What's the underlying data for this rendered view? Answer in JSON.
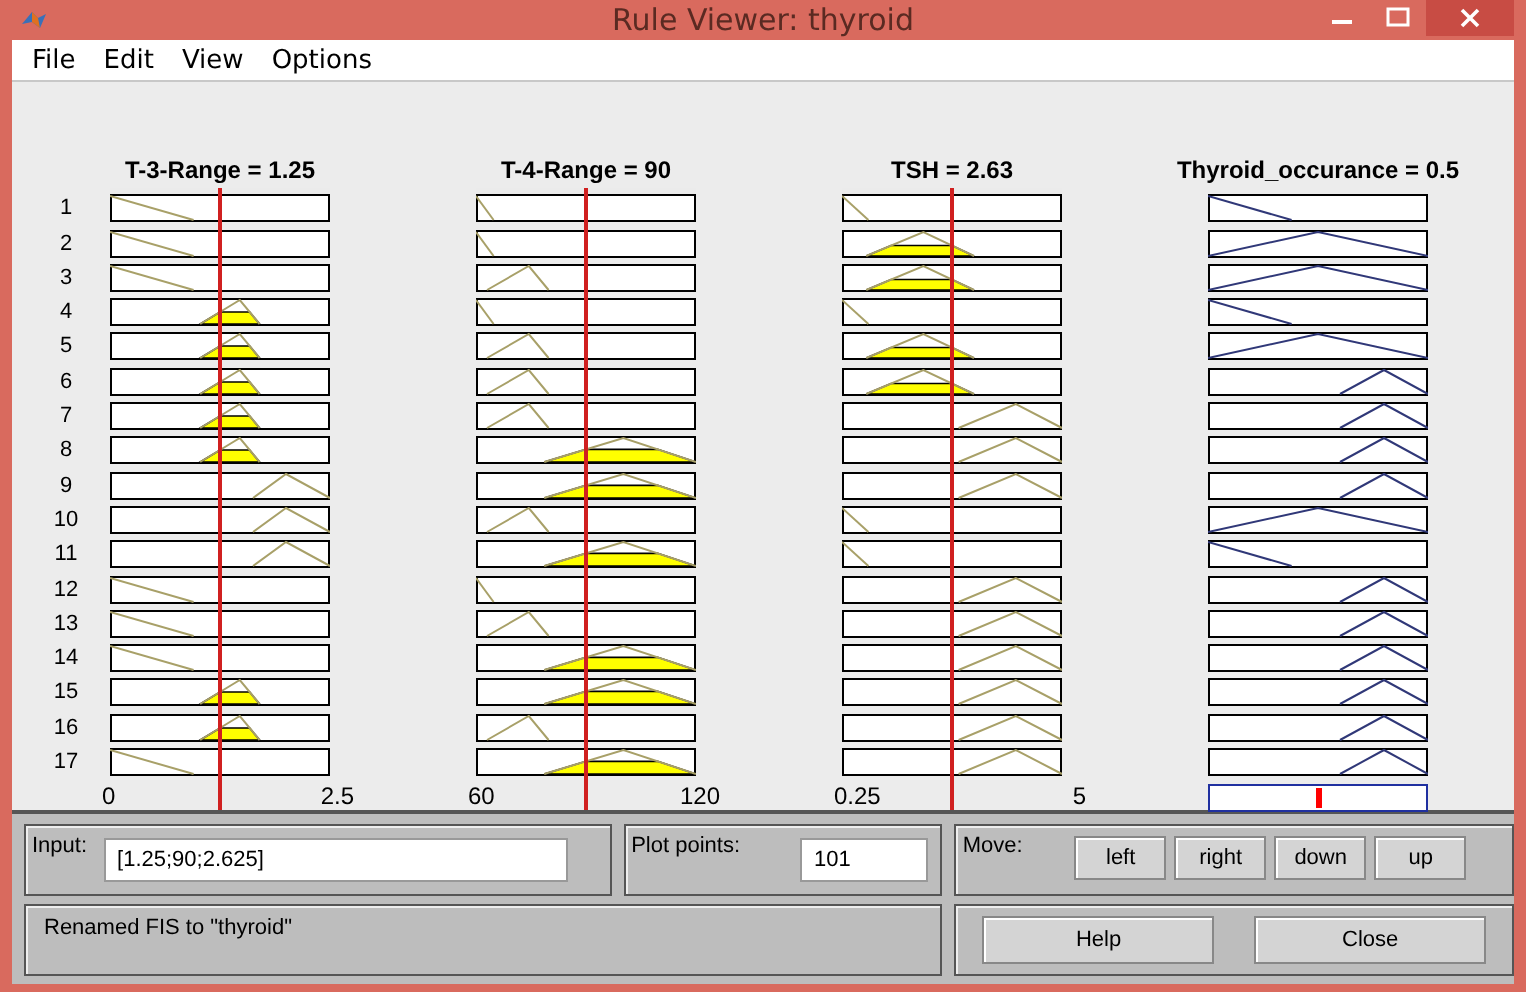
{
  "window": {
    "title": "Rule Viewer: thyroid"
  },
  "menu": [
    "File",
    "Edit",
    "View",
    "Options"
  ],
  "variables": [
    {
      "title": "T-3-Range = 1.25",
      "kind": "input",
      "axis": [
        "0",
        "2.5"
      ],
      "cursor": {
        "level": 0.5
      }
    },
    {
      "title": "T-4-Range = 90",
      "kind": "input",
      "axis": [
        "60",
        "120"
      ],
      "cursor": {
        "level": 0.5
      }
    },
    {
      "title": "TSH = 2.63",
      "kind": "input",
      "axis": [
        "0.25",
        "5"
      ],
      "cursor": {
        "level": 0.5
      }
    },
    {
      "title": "Thyroid_occurance = 0.5",
      "kind": "output",
      "result": {
        "level": 0.5
      }
    }
  ],
  "rules": [
    {
      "number": "1",
      "cells": [
        {
          "kind": "low"
        },
        {
          "kind": "low"
        },
        {
          "kind": "low"
        },
        {
          "kind": "low"
        }
      ]
    },
    {
      "number": "2",
      "cells": [
        {
          "kind": "low"
        },
        {
          "kind": "low"
        },
        {
          "kind": "mid"
        },
        {
          "kind": "mid"
        }
      ]
    },
    {
      "number": "3",
      "cells": [
        {
          "kind": "low"
        },
        {
          "kind": "mid"
        },
        {
          "kind": "mid"
        },
        {
          "kind": "mid"
        }
      ]
    },
    {
      "number": "4",
      "cells": [
        {
          "kind": "mid"
        },
        {
          "kind": "low"
        },
        {
          "kind": "low"
        },
        {
          "kind": "low"
        }
      ]
    },
    {
      "number": "5",
      "cells": [
        {
          "kind": "mid"
        },
        {
          "kind": "mid"
        },
        {
          "kind": "mid"
        },
        {
          "kind": "mid"
        }
      ]
    },
    {
      "number": "6",
      "cells": [
        {
          "kind": "mid"
        },
        {
          "kind": "mid"
        },
        {
          "kind": "mid"
        },
        {
          "kind": "high"
        }
      ]
    },
    {
      "number": "7",
      "cells": [
        {
          "kind": "mid"
        },
        {
          "kind": "mid"
        },
        {
          "kind": "high"
        },
        {
          "kind": "high"
        }
      ]
    },
    {
      "number": "8",
      "cells": [
        {
          "kind": "mid"
        },
        {
          "kind": "high"
        },
        {
          "kind": "high"
        },
        {
          "kind": "high"
        }
      ]
    },
    {
      "number": "9",
      "cells": [
        {
          "kind": "high"
        },
        {
          "kind": "high"
        },
        {
          "kind": "high"
        },
        {
          "kind": "high"
        }
      ]
    },
    {
      "number": "10",
      "cells": [
        {
          "kind": "high"
        },
        {
          "kind": "mid"
        },
        {
          "kind": "low"
        },
        {
          "kind": "mid"
        }
      ]
    },
    {
      "number": "11",
      "cells": [
        {
          "kind": "high"
        },
        {
          "kind": "high"
        },
        {
          "kind": "low"
        },
        {
          "kind": "low"
        }
      ]
    },
    {
      "number": "12",
      "cells": [
        {
          "kind": "low"
        },
        {
          "kind": "low"
        },
        {
          "kind": "high"
        },
        {
          "kind": "high"
        }
      ]
    },
    {
      "number": "13",
      "cells": [
        {
          "kind": "low"
        },
        {
          "kind": "mid"
        },
        {
          "kind": "high"
        },
        {
          "kind": "high"
        }
      ]
    },
    {
      "number": "14",
      "cells": [
        {
          "kind": "low"
        },
        {
          "kind": "high"
        },
        {
          "kind": "high"
        },
        {
          "kind": "high"
        }
      ]
    },
    {
      "number": "15",
      "cells": [
        {
          "kind": "mid"
        },
        {
          "kind": "high"
        },
        {
          "kind": "high"
        },
        {
          "kind": "high"
        }
      ]
    },
    {
      "number": "16",
      "cells": [
        {
          "kind": "mid"
        },
        {
          "kind": "mid"
        },
        {
          "kind": "high"
        },
        {
          "kind": "high"
        }
      ]
    },
    {
      "number": "17",
      "cells": [
        {
          "kind": "low"
        },
        {
          "kind": "high"
        },
        {
          "kind": "high"
        },
        {
          "kind": "high"
        }
      ]
    }
  ],
  "input": {
    "label": "Input:",
    "value": "[1.25;90;2.625]"
  },
  "plot_points": {
    "label": "Plot points:",
    "value": "101"
  },
  "move": {
    "label": "Move:",
    "buttons": [
      "left",
      "right",
      "down",
      "up"
    ]
  },
  "status": "Renamed FIS to \"thyroid\"",
  "buttons": [
    "Help",
    "Close"
  ]
}
